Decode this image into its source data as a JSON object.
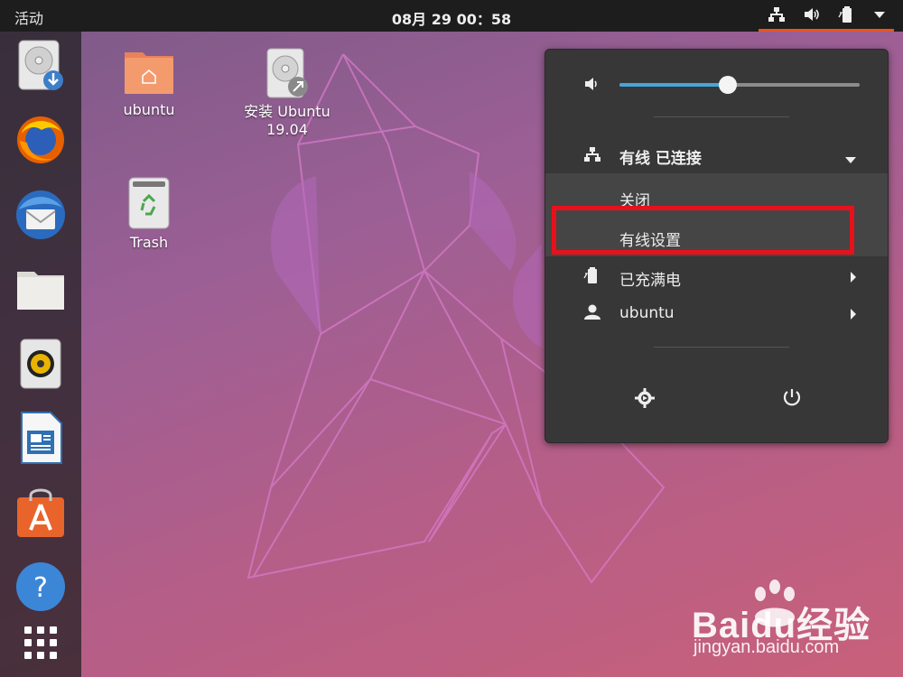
{
  "topbar": {
    "activities_label": "活动",
    "clock": "08月 29  00：58"
  },
  "tray": {
    "icons": [
      "network-wired-icon",
      "volume-icon",
      "battery-icon",
      "dropdown-icon"
    ]
  },
  "dock": {
    "items": [
      {
        "name": "install-drive",
        "icon": "disk-download-icon"
      },
      {
        "name": "firefox",
        "icon": "firefox-icon"
      },
      {
        "name": "thunderbird",
        "icon": "thunderbird-icon"
      },
      {
        "name": "files",
        "icon": "folder-icon"
      },
      {
        "name": "rhythmbox",
        "icon": "speaker-icon"
      },
      {
        "name": "libreoffice-writer",
        "icon": "writer-icon"
      },
      {
        "name": "software",
        "icon": "software-center-icon"
      },
      {
        "name": "help",
        "icon": "help-icon"
      },
      {
        "name": "show-apps",
        "icon": "app-grid-icon"
      }
    ]
  },
  "desktop": {
    "home_label": "ubuntu",
    "install_label_line1": "安装 Ubuntu",
    "install_label_line2": "19.04",
    "trash_label": "Trash"
  },
  "system_menu": {
    "volume_level": 0.45,
    "wired_label": "有线 已连接",
    "wired_off": "关闭",
    "wired_settings": "有线设置",
    "battery_label": "已充满电",
    "user_label": "ubuntu"
  },
  "colors": {
    "accent": "#e95420",
    "slider": "#45a6d9",
    "highlight": "#e8111b",
    "menu_bg": "#373737"
  },
  "watermark": {
    "brand": "Baidu经验",
    "url": "jingyan.baidu.com"
  }
}
